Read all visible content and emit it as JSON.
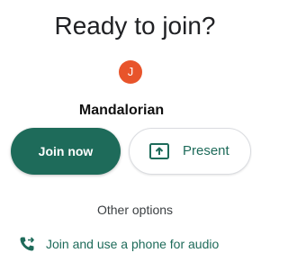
{
  "heading": "Ready to join?",
  "user": {
    "avatar_initial": "J",
    "avatar_color": "#e8542b",
    "name": "Mandalorian"
  },
  "actions": {
    "join_label": "Join now",
    "join_color": "#1e6b5a",
    "present_label": "Present",
    "present_icon": "present-screen-icon"
  },
  "other_options_label": "Other options",
  "phone_option": {
    "icon": "phone-forward-icon",
    "label": "Join and use a phone for audio"
  }
}
